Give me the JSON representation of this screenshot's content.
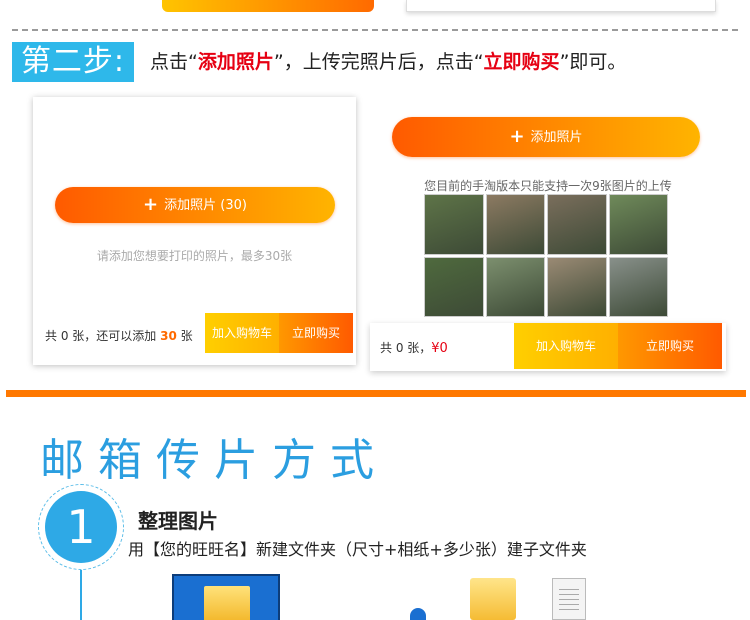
{
  "step2": {
    "badge": "第二步:",
    "instruction_pre": "点击“",
    "add_photo_highlight": "添加照片",
    "instruction_mid": "”，上传完照片后，点击“",
    "buy_highlight": "立即购买",
    "instruction_post": "”即可。"
  },
  "left_panel": {
    "add_button_label": "添加照片 (30)",
    "hint": "请添加您想要打印的照片，最多30张",
    "count_pre": "共 0 张，还可以添加 ",
    "count_num": "30",
    "count_post": " 张",
    "cart_label": "加入购物车",
    "buy_label": "立即购买"
  },
  "right_panel": {
    "add_button_label": "添加照片",
    "hint": "您目前的手淘版本只能支持一次9张图片的上传",
    "photos": [
      {
        "name": "monkey-photo-1",
        "color": "#5e7448"
      },
      {
        "name": "monkey-photo-2",
        "color": "#8c7a62"
      },
      {
        "name": "monkey-photo-3",
        "color": "#7a6e5c"
      },
      {
        "name": "monkey-photo-4",
        "color": "#6f8a5a"
      },
      {
        "name": "monkey-photo-5",
        "color": "#4f6a3e"
      },
      {
        "name": "monkey-photo-6",
        "color": "#7c8f6e"
      },
      {
        "name": "monkey-photo-7",
        "color": "#9a8a74"
      },
      {
        "name": "monkey-photo-8",
        "color": "#88908a"
      }
    ],
    "count_pre": "共 0 张，",
    "price": "¥0",
    "cart_label": "加入购物车",
    "buy_label": "立即购买"
  },
  "mail_section": {
    "title": "邮箱传片方式",
    "step_number": "1",
    "step_title": "整理图片",
    "step_desc": "用【您的旺旺名】新建文件夹（尺寸+相纸+多少张）建子文件夹"
  },
  "colors": {
    "accent_blue": "#2eb8ea",
    "accent_orange": "#ff7800",
    "highlight_red": "#e60012"
  }
}
